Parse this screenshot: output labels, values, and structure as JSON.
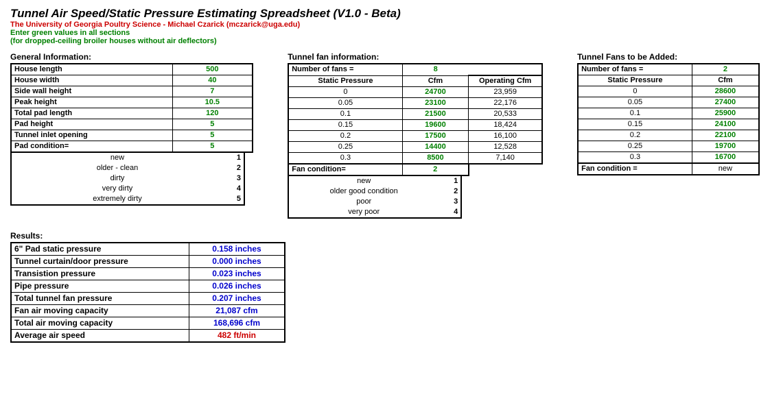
{
  "header": {
    "title": "Tunnel Air Speed/Static Pressure Estimating Spreadsheet  (V1.0 - Beta)",
    "sub_red": "The University of Georgia Poultry Science - Michael Czarick (mczarick@uga.edu)",
    "sub_green1": "Enter green values in all sections",
    "sub_green2": "(for dropped-ceiling broiler houses without air deflectors)"
  },
  "general": {
    "heading": "General Information:",
    "rows": [
      {
        "label": "House length",
        "value": "500"
      },
      {
        "label": "House width",
        "value": "40"
      },
      {
        "label": "Side wall height",
        "value": "7"
      },
      {
        "label": "Peak height",
        "value": "10.5"
      },
      {
        "label": "Total pad length",
        "value": "120"
      },
      {
        "label": "Pad height",
        "value": "5"
      },
      {
        "label": "Tunnel inlet opening",
        "value": "5"
      },
      {
        "label": "Pad condition=",
        "value": "5"
      }
    ],
    "conditions": [
      {
        "label": "new",
        "code": "1"
      },
      {
        "label": "older - clean",
        "code": "2"
      },
      {
        "label": "dirty",
        "code": "3"
      },
      {
        "label": "very dirty",
        "code": "4"
      },
      {
        "label": "extremely dirty",
        "code": "5"
      }
    ]
  },
  "fans": {
    "heading": "Tunnel fan information:",
    "num_label": "Number of fans =",
    "num_value": "8",
    "col1": "Static Pressure",
    "col2": "Cfm",
    "col3": "Operating Cfm",
    "rows": [
      {
        "sp": "0",
        "cfm": "24700",
        "op": "23,959"
      },
      {
        "sp": "0.05",
        "cfm": "23100",
        "op": "22,176"
      },
      {
        "sp": "0.1",
        "cfm": "21500",
        "op": "20,533"
      },
      {
        "sp": "0.15",
        "cfm": "19600",
        "op": "18,424"
      },
      {
        "sp": "0.2",
        "cfm": "17500",
        "op": "16,100"
      },
      {
        "sp": "0.25",
        "cfm": "14400",
        "op": "12,528"
      },
      {
        "sp": "0.3",
        "cfm": "8500",
        "op": "7,140"
      }
    ],
    "cond_label": "Fan condition=",
    "cond_value": "2",
    "conditions": [
      {
        "label": "new",
        "code": "1"
      },
      {
        "label": "older good condition",
        "code": "2"
      },
      {
        "label": "poor",
        "code": "3"
      },
      {
        "label": "very poor",
        "code": "4"
      }
    ]
  },
  "added": {
    "heading": "Tunnel Fans to be Added:",
    "num_label": "Number of fans =",
    "num_value": "2",
    "col1": "Static Pressure",
    "col2": "Cfm",
    "rows": [
      {
        "sp": "0",
        "cfm": "28600"
      },
      {
        "sp": "0.05",
        "cfm": "27400"
      },
      {
        "sp": "0.1",
        "cfm": "25900"
      },
      {
        "sp": "0.15",
        "cfm": "24100"
      },
      {
        "sp": "0.2",
        "cfm": "22100"
      },
      {
        "sp": "0.25",
        "cfm": "19700"
      },
      {
        "sp": "0.3",
        "cfm": "16700"
      }
    ],
    "cond_label": "Fan condition =",
    "cond_value": "new"
  },
  "results": {
    "heading": "Results:",
    "rows": [
      {
        "label": "6\" Pad static pressure",
        "value": "0.158 inches",
        "cls": "blue"
      },
      {
        "label": "Tunnel curtain/door pressure",
        "value": "0.000 inches",
        "cls": "blue"
      },
      {
        "label": "Transistion pressure",
        "value": "0.023 inches",
        "cls": "blue"
      },
      {
        "label": "Pipe pressure",
        "value": "0.026 inches",
        "cls": "blue"
      },
      {
        "label": "Total tunnel fan pressure",
        "value": "0.207 inches",
        "cls": "blue"
      },
      {
        "label": "Fan air moving capacity",
        "value": "21,087 cfm",
        "cls": "blue"
      },
      {
        "label": "Total air moving capacity",
        "value": "168,696 cfm",
        "cls": "blue"
      },
      {
        "label": "Average air speed",
        "value": "482 ft/min",
        "cls": "red"
      }
    ]
  }
}
